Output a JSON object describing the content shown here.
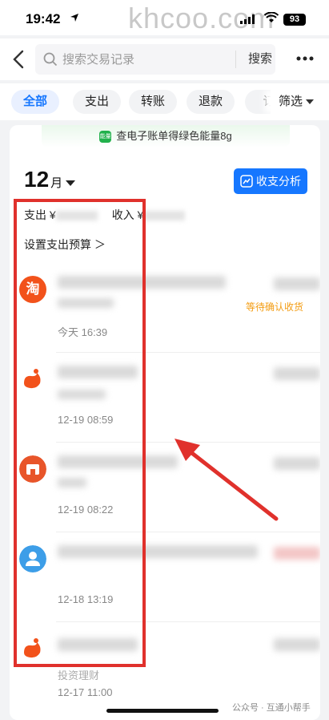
{
  "status_bar": {
    "time": "19:42",
    "battery": "93",
    "watermark": "khcoo.com"
  },
  "search": {
    "placeholder": "搜索交易记录",
    "button_label": "搜索"
  },
  "filters": {
    "chips": [
      "全部",
      "支出",
      "转账",
      "退款",
      "订"
    ],
    "active_index": 0,
    "filter_label": "筛选"
  },
  "banner": {
    "badge": "能量",
    "text": "查电子账单得绿色能量8g"
  },
  "month": {
    "number": "12",
    "unit": "月"
  },
  "analysis_button": "收支分析",
  "summary": {
    "expense_label": "支出 ¥",
    "income_label": "收入 ¥"
  },
  "budget_link": "设置支出预算 ＞",
  "transactions": [
    {
      "icon_text": "淘",
      "icon_color": "#f2521b",
      "time": "今天 16:39",
      "status": "等待确认收货",
      "sub": ""
    },
    {
      "icon_text": "",
      "icon_color": "#f2521b",
      "time": "12-19 08:59",
      "status": "",
      "sub": ""
    },
    {
      "icon_text": "",
      "icon_color": "#e8552a",
      "time": "12-19 08:22",
      "status": "",
      "sub": ""
    },
    {
      "icon_text": "",
      "icon_color": "#3d9ee8",
      "time": "12-18 13:19",
      "status": "",
      "sub": ""
    },
    {
      "icon_text": "",
      "icon_color": "#f2521b",
      "time": "12-17 11:00",
      "status": "",
      "sub": "投资理财"
    }
  ],
  "footer": {
    "watermark": "公众号 · 互通小帮手"
  },
  "colors": {
    "accent": "#1677ff",
    "highlight": "#e0312c",
    "status_orange": "#f39c12"
  }
}
